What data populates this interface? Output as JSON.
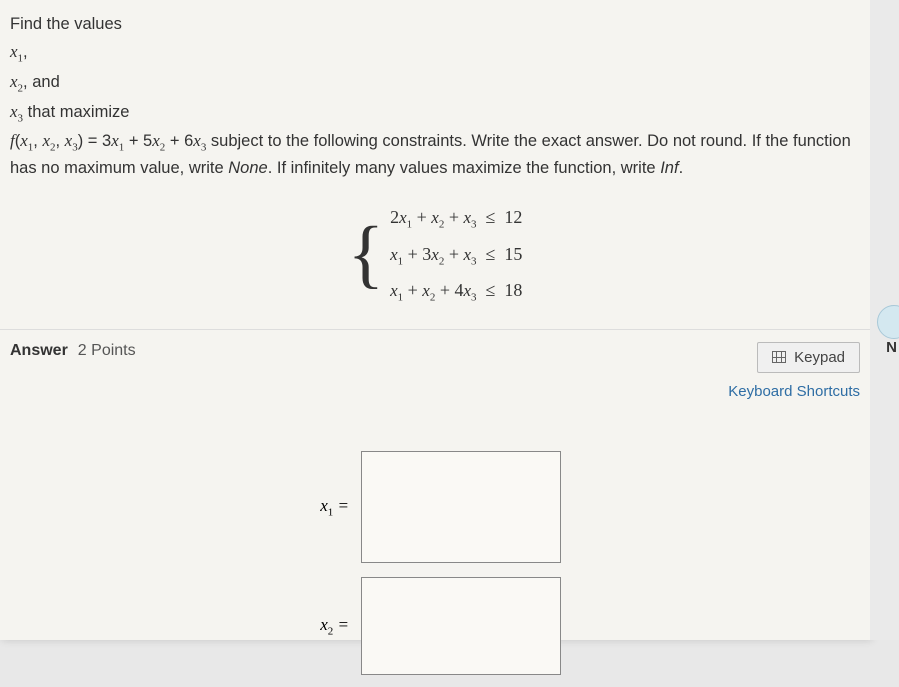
{
  "question": {
    "intro": "Find the values",
    "var1": "x",
    "var1_sub": "1",
    "var1_suffix": ",",
    "var2": "x",
    "var2_sub": "2",
    "var2_suffix": ", and",
    "var3": "x",
    "var3_sub": "3",
    "var3_suffix": " that maximize",
    "func_lhs_f": "f",
    "func_lhs_open": "(",
    "func_lhs_x1": "x",
    "func_lhs_x1s": "1",
    "func_lhs_c1": ", ",
    "func_lhs_x2": "x",
    "func_lhs_x2s": "2",
    "func_lhs_c2": ", ",
    "func_lhs_x3": "x",
    "func_lhs_x3s": "3",
    "func_lhs_close": ") = 3",
    "func_t1x": "x",
    "func_t1s": "1",
    "func_p1": " + 5",
    "func_t2x": "x",
    "func_t2s": "2",
    "func_p2": " + 6",
    "func_t3x": "x",
    "func_t3s": "3",
    "func_tail": " subject to the following constraints. Write the exact answer. Do not round. If the function has no maximum value, write ",
    "none_word": "None",
    "tail2": ". If infinitely many values maximize the function, write ",
    "inf_word": "Inf",
    "tail3": "."
  },
  "constraints": {
    "row1": "2x₁ + x₂ + x₃  ≤  12",
    "row2": "x₁ + 3x₂ + x₃  ≤  15",
    "row3": "x₁ + x₂ + 4x₃  ≤  18"
  },
  "answer": {
    "label": "Answer",
    "points": "2 Points",
    "keypad": "Keypad",
    "shortcuts": "Keyboard Shortcuts",
    "x1_label": "x₁ =",
    "x2_label": "x₂ =",
    "x1_value": "",
    "x2_value": ""
  },
  "side": {
    "n": "N"
  }
}
